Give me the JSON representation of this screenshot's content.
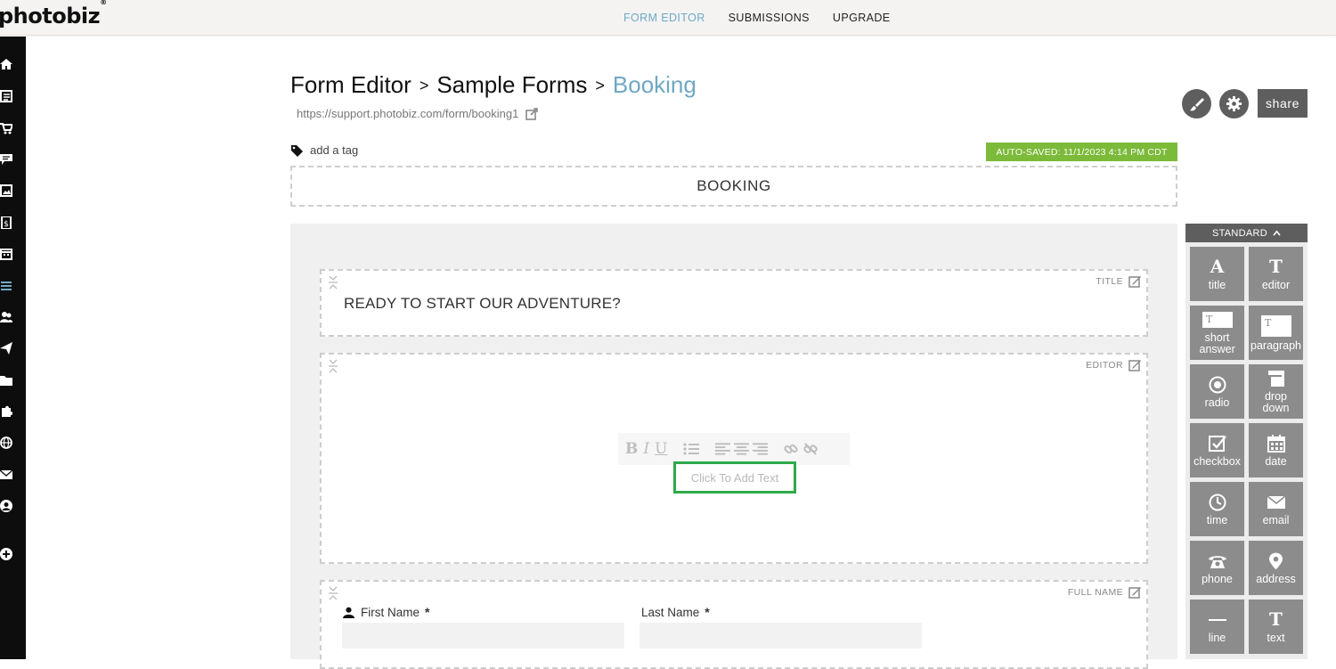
{
  "app": {
    "logo": "photobiz",
    "logo_mark": "®"
  },
  "topnav": [
    {
      "label": "FORM EDITOR",
      "active": true
    },
    {
      "label": "SUBMISSIONS",
      "active": false
    },
    {
      "label": "UPGRADE",
      "active": false
    }
  ],
  "sidebar_icons": [
    "home-icon",
    "page-icon",
    "cart-icon",
    "chat-icon",
    "gallery-icon",
    "invoice-icon",
    "calendar-icon",
    "forms-icon",
    "clients-icon",
    "send-icon",
    "folder-icon",
    "plugin-icon",
    "globe-icon",
    "mail-icon",
    "account-icon",
    "add-icon"
  ],
  "header": {
    "crumbs": [
      "Form Editor",
      "Sample Forms",
      "Booking"
    ],
    "separator": ">",
    "url": "https://support.photobiz.com/form/booking1",
    "share_label": "share"
  },
  "tag": {
    "label": "add a tag"
  },
  "autosave": {
    "text": "AUTO-SAVED: 11/1/2023 4:14 PM CDT",
    "color": "#7cba3a"
  },
  "form": {
    "title": "BOOKING",
    "blocks": {
      "title": {
        "type_label": "TITLE",
        "text": "READY TO START OUR ADVENTURE?"
      },
      "editor": {
        "type_label": "EDITOR",
        "placeholder": "Click To Add Text"
      },
      "full_name": {
        "type_label": "FULL NAME",
        "first_label": "First Name",
        "last_label": "Last Name",
        "required_mark": "*"
      }
    }
  },
  "panel": {
    "header": "STANDARD",
    "tiles": [
      {
        "id": "title",
        "label": "title",
        "icon": "A"
      },
      {
        "id": "editor",
        "label": "editor",
        "icon": "T"
      },
      {
        "id": "short",
        "label": "short answer",
        "icon": "short-answer-icon"
      },
      {
        "id": "paragraph",
        "label": "paragraph",
        "icon": "paragraph-icon"
      },
      {
        "id": "radio",
        "label": "radio",
        "icon": "radio-icon"
      },
      {
        "id": "dropdown",
        "label": "drop down",
        "icon": "dropdown-icon"
      },
      {
        "id": "checkbox",
        "label": "checkbox",
        "icon": "checkbox-icon"
      },
      {
        "id": "date",
        "label": "date",
        "icon": "calendar-icon"
      },
      {
        "id": "time",
        "label": "time",
        "icon": "clock-icon"
      },
      {
        "id": "email",
        "label": "email",
        "icon": "envelope-icon"
      },
      {
        "id": "phone",
        "label": "phone",
        "icon": "phone-icon"
      },
      {
        "id": "address",
        "label": "address",
        "icon": "pin-icon"
      },
      {
        "id": "line",
        "label": "line",
        "icon": "line-icon"
      },
      {
        "id": "text",
        "label": "text",
        "icon": "T"
      }
    ]
  },
  "colors": {
    "accent": "#6fa8c5",
    "dark": "#5e5e5e",
    "tile": "#8c8c8c",
    "highlight": "#2eaa4a"
  }
}
